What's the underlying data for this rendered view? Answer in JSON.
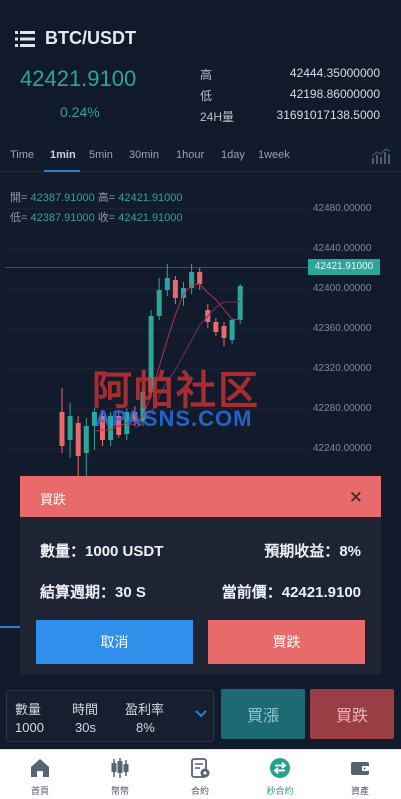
{
  "header": {
    "title": "BTC/USDT",
    "price": "42421.9100",
    "change": "0.24%",
    "stats": [
      {
        "label": "高",
        "value": "42444.35000000"
      },
      {
        "label": "低",
        "value": "42198.86000000"
      },
      {
        "label": "24H量",
        "value": "31691017138.5000"
      }
    ]
  },
  "chart": {
    "tabs": [
      "Time",
      "1min",
      "5min",
      "30min",
      "1hour",
      "1day",
      "1week"
    ],
    "active_tab": "1min",
    "ohlc": {
      "open_label": "開=",
      "open": "42387.91000",
      "high_label": "高=",
      "high": "42421.91000",
      "low_label": "低=",
      "low": "42387.91000",
      "close_label": "收=",
      "close": "42421.91000"
    },
    "axis_labels": [
      "42480.00000",
      "42440.00000",
      "42400.00000",
      "42360.00000",
      "42320.00000",
      "42280.00000",
      "42240.00000"
    ],
    "current_price_tag": "42421.91000",
    "watermark_cn": "阿帕社区",
    "watermark_en": "APASNS.COM",
    "colors": {
      "up": "#2ea59a",
      "down": "#e86a6a",
      "accent": "#2d7fd3"
    }
  },
  "chart_data": {
    "type": "candlestick",
    "ylim": [
      42220,
      42500
    ],
    "candles": [
      {
        "o": 42296,
        "h": 42320,
        "l": 42255,
        "c": 42262
      },
      {
        "o": 42268,
        "h": 42305,
        "l": 42250,
        "c": 42292
      },
      {
        "o": 42285,
        "h": 42292,
        "l": 42226,
        "c": 42252
      },
      {
        "o": 42255,
        "h": 42290,
        "l": 42198,
        "c": 42282
      },
      {
        "o": 42282,
        "h": 42300,
        "l": 42258,
        "c": 42296
      },
      {
        "o": 42292,
        "h": 42298,
        "l": 42262,
        "c": 42268
      },
      {
        "o": 42268,
        "h": 42296,
        "l": 42262,
        "c": 42292
      },
      {
        "o": 42292,
        "h": 42298,
        "l": 42270,
        "c": 42273
      },
      {
        "o": 42274,
        "h": 42300,
        "l": 42268,
        "c": 42296
      },
      {
        "o": 42296,
        "h": 42302,
        "l": 42282,
        "c": 42286
      },
      {
        "o": 42286,
        "h": 42320,
        "l": 42282,
        "c": 42316
      },
      {
        "o": 42316,
        "h": 42398,
        "l": 42312,
        "c": 42392
      },
      {
        "o": 42392,
        "h": 42430,
        "l": 42388,
        "c": 42418
      },
      {
        "o": 42418,
        "h": 42444,
        "l": 42412,
        "c": 42430
      },
      {
        "o": 42428,
        "h": 42432,
        "l": 42404,
        "c": 42410
      },
      {
        "o": 42410,
        "h": 42426,
        "l": 42402,
        "c": 42420
      },
      {
        "o": 42420,
        "h": 42444,
        "l": 42414,
        "c": 42436
      },
      {
        "o": 42436,
        "h": 42440,
        "l": 42418,
        "c": 42424
      },
      {
        "o": 42398,
        "h": 42404,
        "l": 42380,
        "c": 42386
      },
      {
        "o": 42386,
        "h": 42390,
        "l": 42372,
        "c": 42376
      },
      {
        "o": 42382,
        "h": 42386,
        "l": 42362,
        "c": 42370
      },
      {
        "o": 42368,
        "h": 42390,
        "l": 42364,
        "c": 42388
      },
      {
        "o": 42388,
        "h": 42424,
        "l": 42384,
        "c": 42422
      }
    ]
  },
  "modal": {
    "title": "買跌",
    "quantity_label": "數量：",
    "quantity_value": "1000 USDT",
    "expected_label": "預期收益：",
    "expected_value": "8%",
    "period_label": "結算週期：",
    "period_value": "30 S",
    "current_label": "當前價：",
    "current_value": "42421.9100",
    "cancel": "取消",
    "confirm": "買跌"
  },
  "trade": {
    "cols": [
      {
        "label": "數量",
        "value": "1000"
      },
      {
        "label": "時間",
        "value": "30s"
      },
      {
        "label": "盈利率",
        "value": "8%"
      }
    ],
    "buy_up": "買漲",
    "buy_down": "買跌"
  },
  "nav": {
    "items": [
      {
        "label": "首頁",
        "icon": "home-icon"
      },
      {
        "label": "幣幣",
        "icon": "candlestick-icon"
      },
      {
        "label": "合約",
        "icon": "contract-icon"
      },
      {
        "label": "秒合約",
        "icon": "swap-icon"
      },
      {
        "label": "資產",
        "icon": "wallet-icon"
      }
    ],
    "active": 3
  }
}
